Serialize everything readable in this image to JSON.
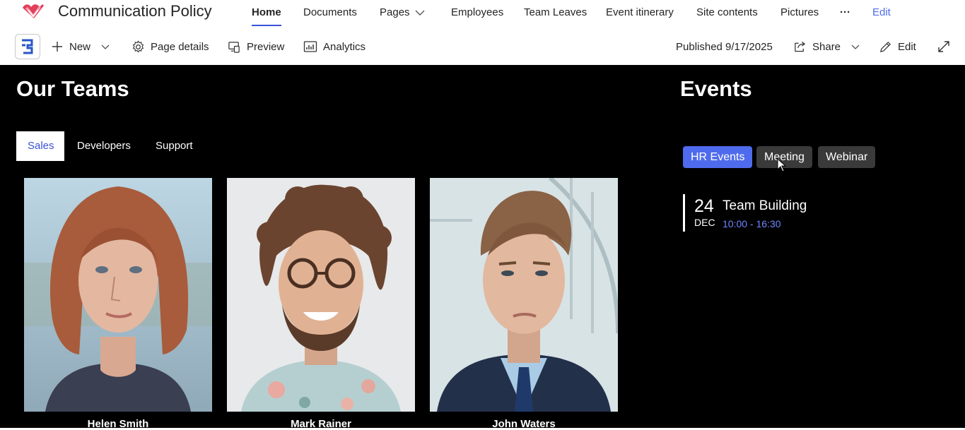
{
  "site": {
    "title": "Communication Policy",
    "nav": [
      {
        "label": "Home",
        "active": true
      },
      {
        "label": "Documents"
      },
      {
        "label": "Pages",
        "has_dropdown": true
      },
      {
        "label": "Employees"
      },
      {
        "label": "Team Leaves"
      },
      {
        "label": "Event itinerary"
      },
      {
        "label": "Site contents"
      },
      {
        "label": "Pictures"
      },
      {
        "label": "···"
      },
      {
        "label": "Edit"
      }
    ]
  },
  "command_bar": {
    "new_label": "New",
    "page_details_label": "Page details",
    "preview_label": "Preview",
    "analytics_label": "Analytics",
    "published_label": "Published 9/17/2025",
    "share_label": "Share",
    "edit_label": "Edit"
  },
  "teams": {
    "title": "Our Teams",
    "tabs": [
      {
        "label": "Sales",
        "active": true
      },
      {
        "label": "Developers"
      },
      {
        "label": "Support"
      }
    ],
    "members": [
      {
        "name": "Helen Smith"
      },
      {
        "name": "Mark Rainer"
      },
      {
        "name": "John Waters"
      }
    ]
  },
  "events": {
    "title": "Events",
    "filters": [
      {
        "label": "HR Events",
        "active": true
      },
      {
        "label": "Meeting"
      },
      {
        "label": "Webinar"
      }
    ],
    "items": [
      {
        "day": "24",
        "month": "DEC",
        "title": "Team Building",
        "time": "10:00 - 16:30"
      }
    ]
  },
  "colors": {
    "accent": "#4f6bed",
    "nav_underline": "#3b52d8",
    "content_background": "#000000",
    "event_time": "#6f86ff",
    "chip_inactive": "#3a3a3a"
  }
}
